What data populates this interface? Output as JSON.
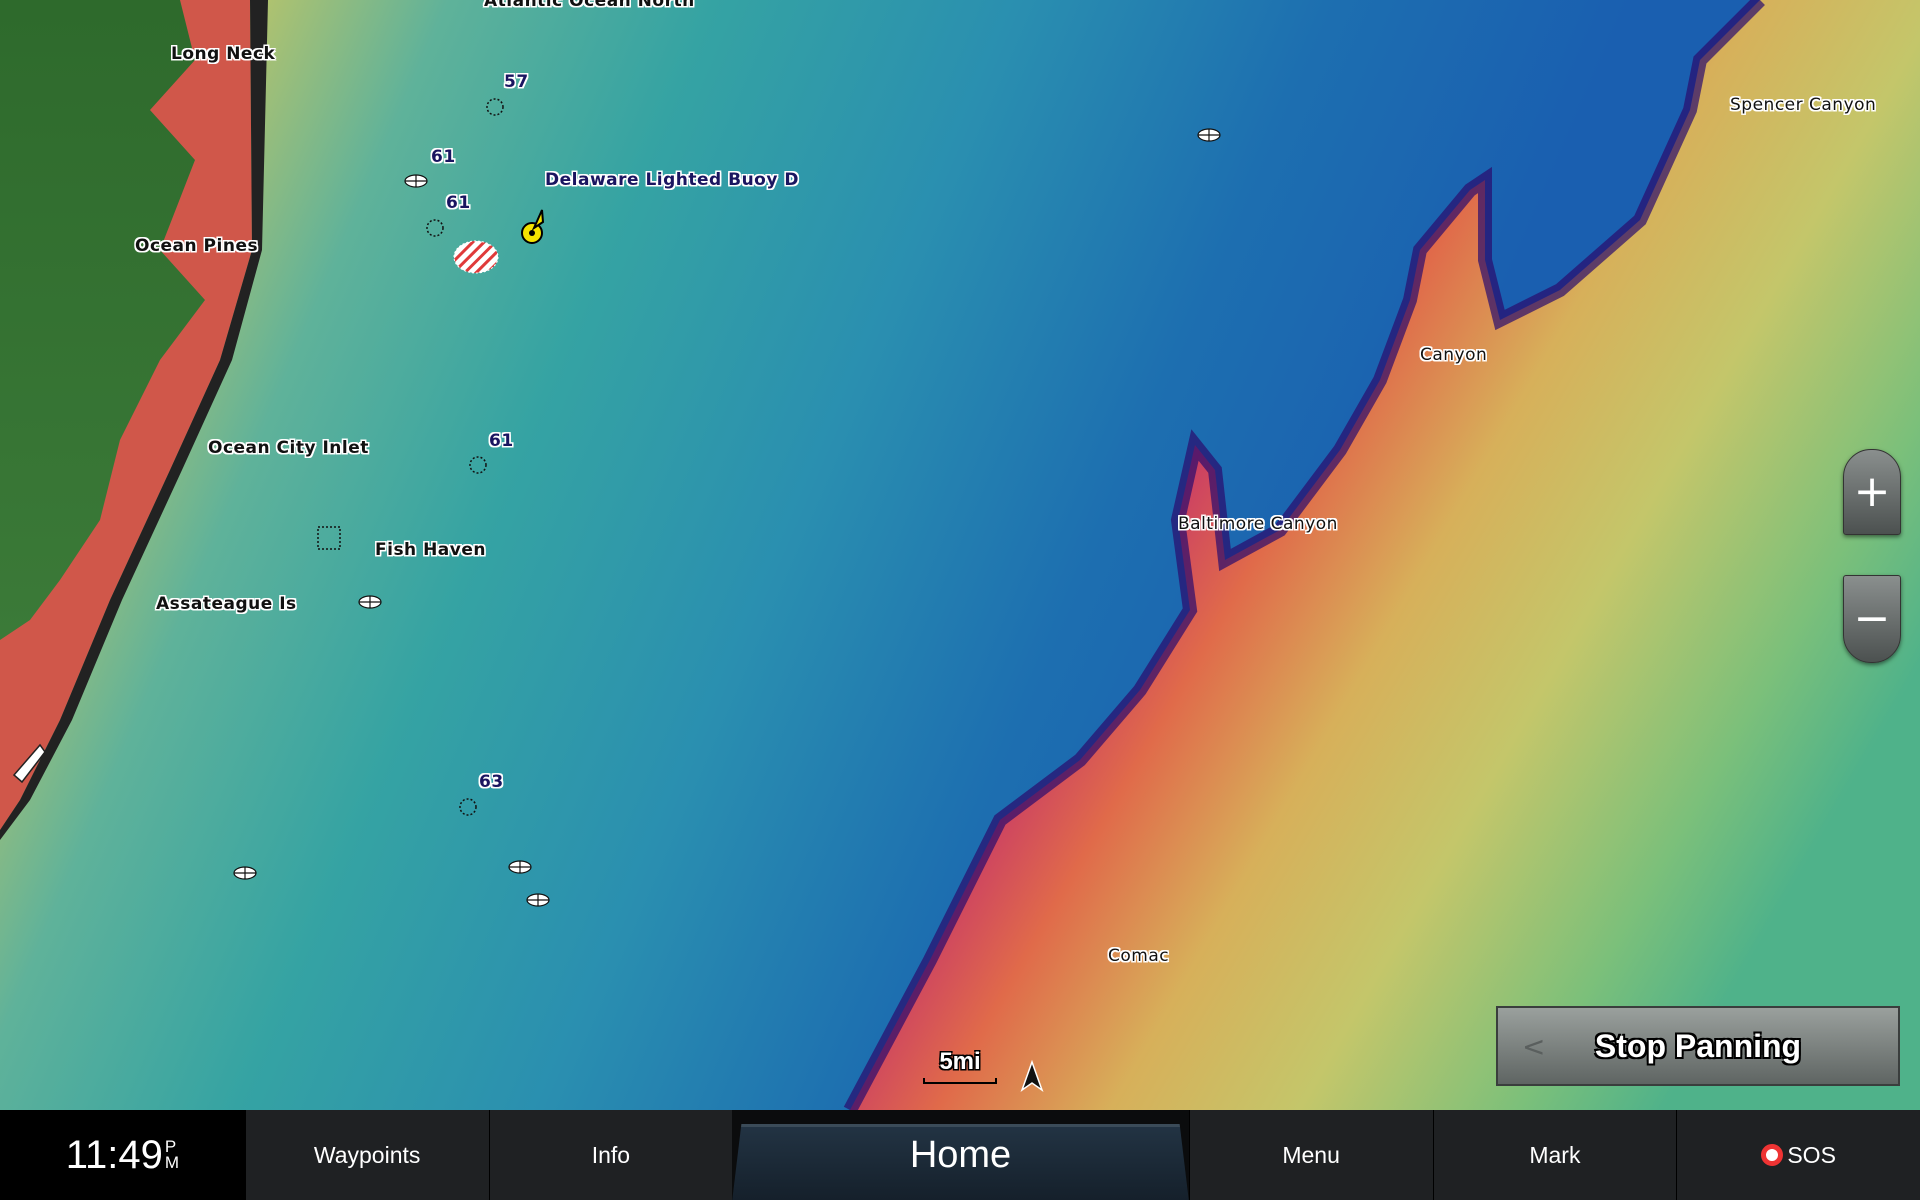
{
  "map": {
    "labels": {
      "atlantic": "Atlantic Ocean North",
      "long_neck": "Long Neck",
      "ocean_pines": "Ocean Pines",
      "ocean_city_inlet": "Ocean City Inlet",
      "fish_haven": "Fish Haven",
      "assateague": "Assateague Is",
      "delaware_buoy": "Delaware Lighted Buoy D",
      "spencer_canyon": "Spencer Canyon",
      "canyon": "Canyon",
      "baltimore_canyon": "Baltimore Canyon",
      "comac": "Comac"
    },
    "depths": [
      "57",
      "61",
      "61",
      "61",
      "63"
    ],
    "scale": "5mi",
    "colors": {
      "land": "#2f6b2f",
      "shore": "#d0574a",
      "shallow": "#c9c76a",
      "mid": "#3aa3a0",
      "deep": "#1a66a8",
      "canyon_wall": "#6a1bb0"
    }
  },
  "controls": {
    "zoom_in": "+",
    "zoom_out": "−",
    "stop_panning": "Stop Panning",
    "stop_panning_chevron": "<"
  },
  "bottom_bar": {
    "time": "11:49",
    "ampm_top": "P",
    "ampm_bottom": "M",
    "tabs": [
      "Waypoints",
      "Info",
      "Home",
      "Menu",
      "Mark",
      "SOS"
    ]
  }
}
